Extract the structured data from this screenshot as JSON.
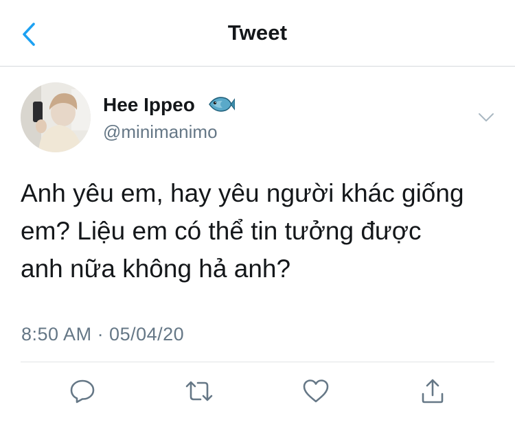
{
  "header": {
    "title": "Tweet",
    "back_icon": "chevron-left-icon",
    "accent_color": "#1da1f2"
  },
  "tweet": {
    "author": {
      "display_name": "Hee Ippeo",
      "name_emoji_icon": "fish-icon",
      "handle": "@minimanimo"
    },
    "menu_icon": "chevron-down-icon",
    "text_lines": [
      "Anh yêu em, hay yêu người khác giống",
      "em? Liệu em có thể tin tưởng được",
      "anh nữa không hả anh?"
    ],
    "timestamp": "8:50 AM · 05/04/20"
  },
  "actions": [
    {
      "icon": "reply-icon"
    },
    {
      "icon": "retweet-icon"
    },
    {
      "icon": "like-icon"
    },
    {
      "icon": "share-icon"
    }
  ]
}
